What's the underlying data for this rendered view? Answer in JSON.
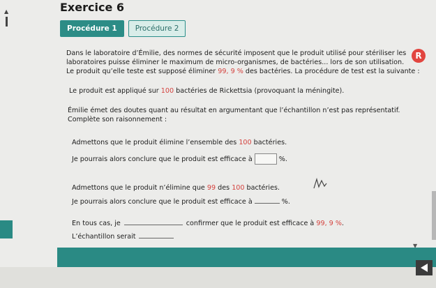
{
  "exercise": {
    "title": "Exercice 6"
  },
  "tabs": [
    {
      "label": "Procédure 1",
      "active": true
    },
    {
      "label": "Procédure 2",
      "active": false
    }
  ],
  "intro": {
    "line1": "Dans le laboratoire d’Émilie, des normes de sécurité imposent que le produit utilisé pour stériliser les",
    "line2": "laboratoires puisse éliminer le maximum de micro-organismes, de bactéries... lors de son utilisation.",
    "line3_a": "Le produit qu’elle teste est supposé éliminer ",
    "line3_value": "99, 9 %",
    "line3_b": " des bactéries. La procédure de test est la suivante :"
  },
  "step1": {
    "text_a": "Le produit est appliqué sur ",
    "count": "100",
    "text_b": " bactéries de Rickettsia (provoquant la méningite)."
  },
  "doubt": {
    "line1": "Émilie émet des doutes quant au résultat en argumentant que l’échantillon n’est pas représentatif.",
    "line2": "Complète son raisonnement :"
  },
  "reason1": {
    "text_a": "Admettons que le produit élimine l’ensemble des ",
    "count": "100",
    "text_b": " bactéries.",
    "conclusion_a": "Je pourrais alors conclure que le produit est efficace à",
    "conclusion_unit": "%."
  },
  "reason2": {
    "text_a": "Admettons que le produit n’élimine que ",
    "count_a": "99",
    "text_b": " des ",
    "count_b": "100",
    "text_c": " bactéries.",
    "conclusion_a": "Je pourrais alors conclure que le produit est efficace à",
    "conclusion_unit": "%."
  },
  "final": {
    "line1_a": "En tous cas, je",
    "line1_b": "confirmer que le produit est efficace à ",
    "line1_value": "99, 9 %",
    "line1_end": ".",
    "line2": "L’échantillon serait"
  },
  "badge": {
    "letter": "R",
    "color": "#e2453f"
  },
  "colors": {
    "accent": "#2c8c86",
    "highlight": "#d4423e"
  }
}
